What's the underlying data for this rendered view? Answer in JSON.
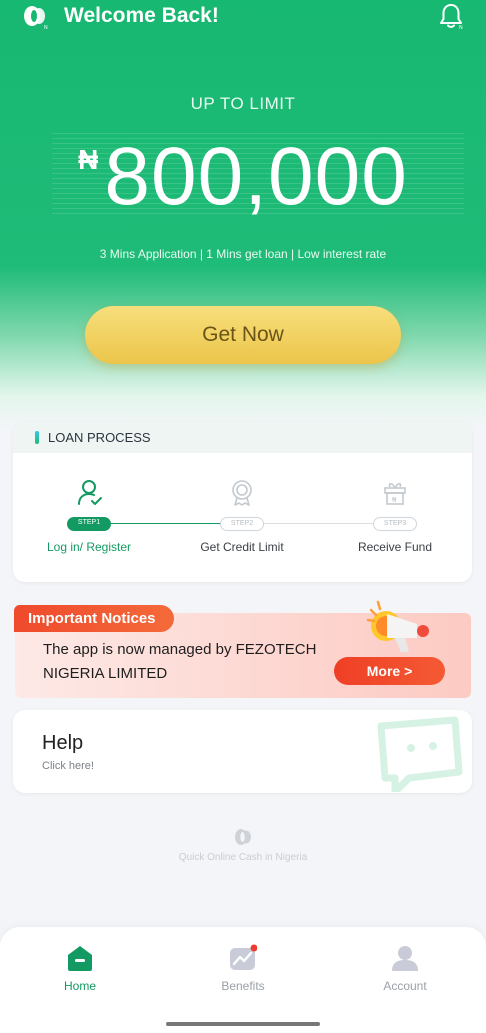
{
  "header": {
    "title": "Welcome Back!",
    "icons": {
      "logo": "app-logo",
      "notifications": "bell-icon"
    }
  },
  "hero": {
    "limit_label": "UP TO LIMIT",
    "currency_symbol": "₦",
    "amount": "800,000",
    "tagline": "3 Mins Application | 1 Mins get loan | Low interest rate",
    "cta_label": "Get Now"
  },
  "loan_process": {
    "title": "LOAN PROCESS",
    "steps": [
      {
        "pill": "STEP1",
        "label": "Log in/ Register",
        "icon": "user-check-icon",
        "active": true
      },
      {
        "pill": "STEP2",
        "label": "Get Credit Limit",
        "icon": "medal-icon",
        "active": false
      },
      {
        "pill": "STEP3",
        "label": "Receive Fund",
        "icon": "gift-icon",
        "active": false
      }
    ]
  },
  "notice": {
    "tag": "Important Notices",
    "text": "The app is now managed by FEZOTECH NIGERIA LIMITED",
    "button": "More >",
    "icon": "megaphone-icon"
  },
  "help": {
    "title": "Help",
    "subtitle": "Click here!",
    "icon": "chat-bubble-icon"
  },
  "footer": {
    "text": "Quick Online Cash in Nigeria"
  },
  "nav": {
    "items": [
      {
        "label": "Home",
        "icon": "home-icon",
        "active": true
      },
      {
        "label": "Benefits",
        "icon": "chart-icon",
        "active": false,
        "badge": true
      },
      {
        "label": "Account",
        "icon": "user-icon",
        "active": false
      }
    ]
  },
  "colors": {
    "primary": "#17b871",
    "accent": "#139a63",
    "cta": "#ecc54a",
    "notice": "#ef4a2c"
  }
}
